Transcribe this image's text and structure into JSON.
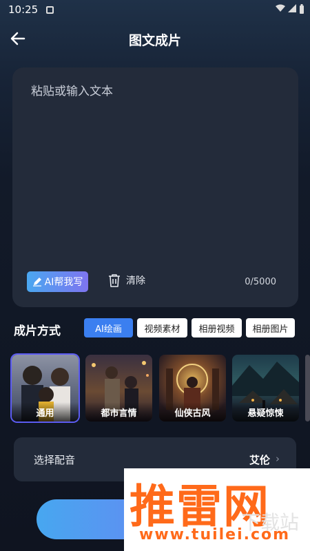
{
  "status_bar": {
    "time": "10:25"
  },
  "header": {
    "title": "图文成片"
  },
  "editor": {
    "placeholder": "粘贴或输入文本",
    "ai_button": "AI帮我写",
    "clear_button": "清除",
    "counter": "0/5000"
  },
  "mode": {
    "label": "成片方式",
    "options": [
      "AI绘画",
      "视频素材",
      "相册视频",
      "相册图片"
    ],
    "selected": "AI绘画"
  },
  "styles": [
    "通用",
    "都市言情",
    "仙侠古风",
    "悬疑惊悚"
  ],
  "voice": {
    "label": "选择配音",
    "value": "艾伦"
  },
  "watermark": {
    "brand": "推雷网",
    "faint": "下载站",
    "url": "www.tuilei.com"
  },
  "colors": {
    "accent": "#3b7ff0",
    "gradient_start": "#47a7f0",
    "gradient_end": "#7e6ff3",
    "watermark": "#ff6a1a"
  }
}
